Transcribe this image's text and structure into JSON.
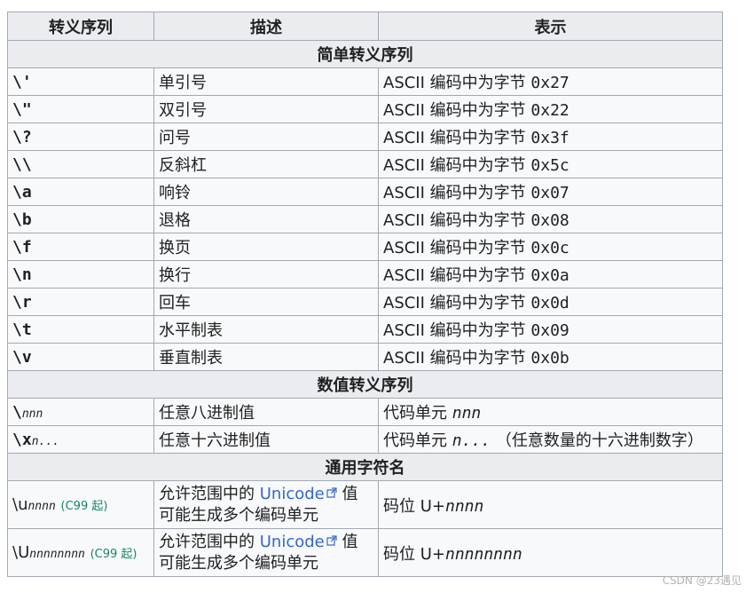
{
  "headers": [
    "转义序列",
    "描述",
    "表示"
  ],
  "sections": {
    "simple": "简单转义序列",
    "numeric": "数值转义序列",
    "universal": "通用字符名"
  },
  "simple_rows": [
    {
      "seq": "\\'",
      "desc": "单引号",
      "rep_prefix": "ASCII 编码中为字节",
      "rep_code": "0x27"
    },
    {
      "seq": "\\\"",
      "desc": "双引号",
      "rep_prefix": "ASCII 编码中为字节",
      "rep_code": "0x22"
    },
    {
      "seq": "\\?",
      "desc": "问号",
      "rep_prefix": "ASCII 编码中为字节",
      "rep_code": "0x3f"
    },
    {
      "seq": "\\\\",
      "desc": "反斜杠",
      "rep_prefix": "ASCII 编码中为字节",
      "rep_code": "0x5c"
    },
    {
      "seq": "\\a",
      "desc": "响铃",
      "rep_prefix": "ASCII 编码中为字节",
      "rep_code": "0x07"
    },
    {
      "seq": "\\b",
      "desc": "退格",
      "rep_prefix": "ASCII 编码中为字节",
      "rep_code": "0x08"
    },
    {
      "seq": "\\f",
      "desc": "换页",
      "rep_prefix": "ASCII 编码中为字节",
      "rep_code": "0x0c"
    },
    {
      "seq": "\\n",
      "desc": "换行",
      "rep_prefix": "ASCII 编码中为字节",
      "rep_code": "0x0a"
    },
    {
      "seq": "\\r",
      "desc": "回车",
      "rep_prefix": "ASCII 编码中为字节",
      "rep_code": "0x0d"
    },
    {
      "seq": "\\t",
      "desc": "水平制表",
      "rep_prefix": "ASCII 编码中为字节",
      "rep_code": "0x09"
    },
    {
      "seq": "\\v",
      "desc": "垂直制表",
      "rep_prefix": "ASCII 编码中为字节",
      "rep_code": "0x0b"
    }
  ],
  "numeric_rows": [
    {
      "seq_prefix": "\\",
      "seq_italic": "nnn",
      "desc": "任意八进制值",
      "rep_prefix": "代码单元",
      "rep_italic": "nnn",
      "rep_suffix": ""
    },
    {
      "seq_prefix": "\\x",
      "seq_italic": "n...",
      "desc": "任意十六进制值",
      "rep_prefix": "代码单元",
      "rep_italic": "n...",
      "rep_suffix": "（任意数量的十六进制数字）"
    }
  ],
  "universal_rows": [
    {
      "seq_prefix": "\\u",
      "seq_italic": "nnnn",
      "note": "(C99 起)",
      "desc_before": "允许范围中的",
      "desc_link": "Unicode",
      "desc_after": "值",
      "desc_line2": "可能生成多个编码单元",
      "rep_prefix": "码位 U+",
      "rep_italic": "nnnn"
    },
    {
      "seq_prefix": "\\U",
      "seq_italic": "nnnnnnnn",
      "note": "(C99 起)",
      "desc_before": "允许范围中的",
      "desc_link": "Unicode",
      "desc_after": "值",
      "desc_line2": "可能生成多个编码单元",
      "rep_prefix": "码位 U+",
      "rep_italic": "nnnnnnnn"
    }
  ],
  "watermark": "CSDN @23遇见",
  "colors": {
    "header_bg": "#eaecf0",
    "cell_bg": "#f8f9fa",
    "border": "#a2a9b1",
    "link": "#3366cc",
    "note": "#14866d"
  }
}
